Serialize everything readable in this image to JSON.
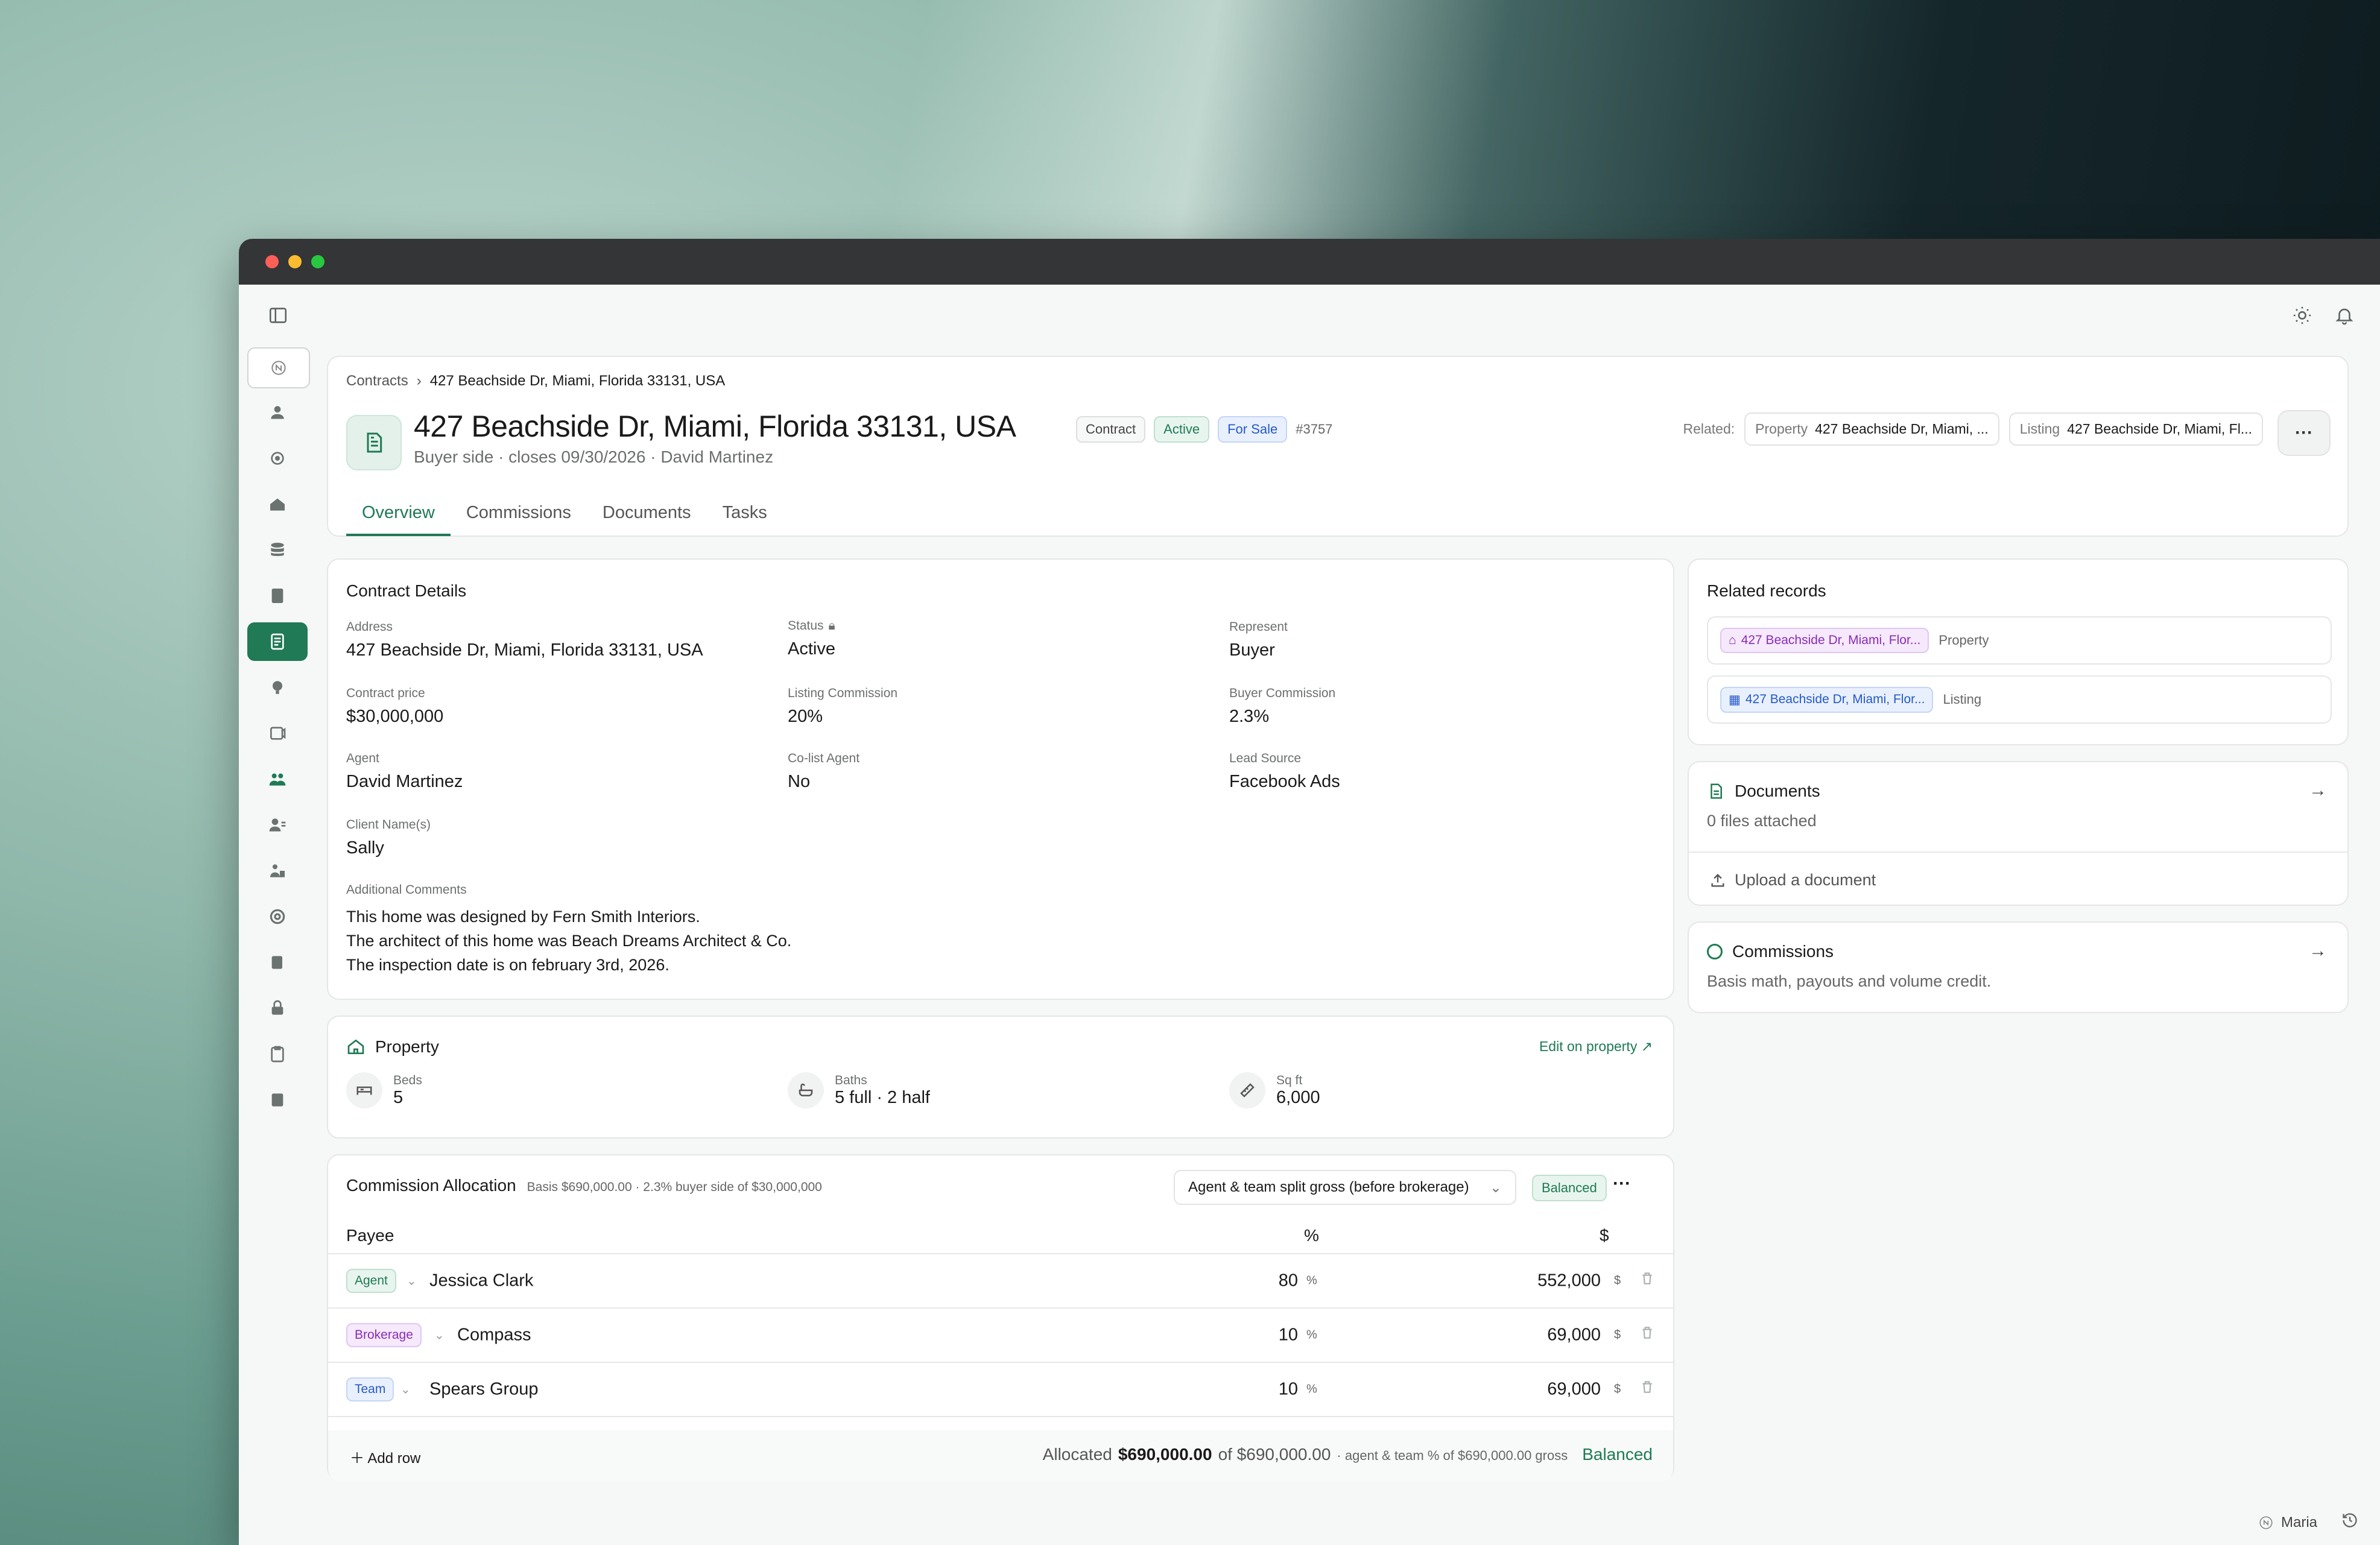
{
  "breadcrumb": {
    "root": "Contracts",
    "current": "427 Beachside Dr, Miami, Florida 33131, USA"
  },
  "header": {
    "title": "427 Beachside Dr, Miami, Florida 33131, USA",
    "subtitle": "Buyer side · closes 09/30/2026 · David Martinez",
    "badges": {
      "type": "Contract",
      "status": "Active",
      "listing": "For Sale",
      "number": "#3757"
    },
    "related_label": "Related:",
    "related": [
      {
        "kind": "Property",
        "value": "427 Beachside Dr, Miami, ..."
      },
      {
        "kind": "Listing",
        "value": "427 Beachside Dr, Miami, Fl..."
      }
    ]
  },
  "tabs": [
    "Overview",
    "Commissions",
    "Documents",
    "Tasks"
  ],
  "details": {
    "title": "Contract Details",
    "address": {
      "label": "Address",
      "value": "427 Beachside Dr, Miami, Florida 33131, USA"
    },
    "status": {
      "label": "Status",
      "value": "Active"
    },
    "represent": {
      "label": "Represent",
      "value": "Buyer"
    },
    "price": {
      "label": "Contract price",
      "value": "$30,000,000"
    },
    "listing_commission": {
      "label": "Listing Commission",
      "value": "20%"
    },
    "buyer_commission": {
      "label": "Buyer Commission",
      "value": "2.3%"
    },
    "agent": {
      "label": "Agent",
      "value": "David Martinez"
    },
    "colist": {
      "label": "Co-list Agent",
      "value": "No"
    },
    "lead_source": {
      "label": "Lead Source",
      "value": "Facebook Ads"
    },
    "client": {
      "label": "Client Name(s)",
      "value": "Sally"
    },
    "comments": {
      "label": "Additional Comments",
      "lines": [
        "This home was designed by Fern Smith Interiors.",
        "The architect of this home was Beach Dreams Architect & Co.",
        "The inspection date is on february 3rd, 2026."
      ]
    }
  },
  "property": {
    "title": "Property",
    "edit_link": "Edit on property ↗",
    "beds": {
      "label": "Beds",
      "value": "5"
    },
    "baths": {
      "label": "Baths",
      "value": "5 full · 2 half"
    },
    "sqft": {
      "label": "Sq ft",
      "value": "6,000"
    }
  },
  "commission": {
    "title": "Commission Allocation",
    "subtitle": "Basis $690,000.00 · 2.3% buyer side of $30,000,000",
    "split_option": "Agent & team split gross (before brokerage)",
    "badge": "Balanced",
    "columns": {
      "payee": "Payee",
      "pct": "%",
      "amount": "$"
    },
    "rows": [
      {
        "role": "Agent",
        "name": "Jessica Clark",
        "pct": "80",
        "amount": "552,000"
      },
      {
        "role": "Brokerage",
        "name": "Compass",
        "pct": "10",
        "amount": "69,000"
      },
      {
        "role": "Team",
        "name": "Spears Group",
        "pct": "10",
        "amount": "69,000"
      }
    ],
    "pct_unit": "%",
    "amount_unit": "$",
    "add_row": "Add row",
    "footer": {
      "allocated_label": "Allocated",
      "allocated": "$690,000.00",
      "of": "of $690,000.00",
      "note": "· agent & team % of $690,000.00 gross",
      "status": "Balanced"
    }
  },
  "related_records": {
    "title": "Related records",
    "items": [
      {
        "name": "427 Beachside Dr, Miami, Flor...",
        "type": "Property"
      },
      {
        "name": "427 Beachside Dr, Miami, Flor...",
        "type": "Listing"
      }
    ]
  },
  "documents": {
    "title": "Documents",
    "sub": "0 files attached",
    "upload": "Upload a document"
  },
  "commissions_side": {
    "title": "Commissions",
    "sub": "Basis math, payouts and volume credit."
  },
  "user": {
    "name": "Maria"
  },
  "colors": {
    "accent": "#1f7a55",
    "purple": "#8a2bb8",
    "blue": "#2459c9"
  }
}
